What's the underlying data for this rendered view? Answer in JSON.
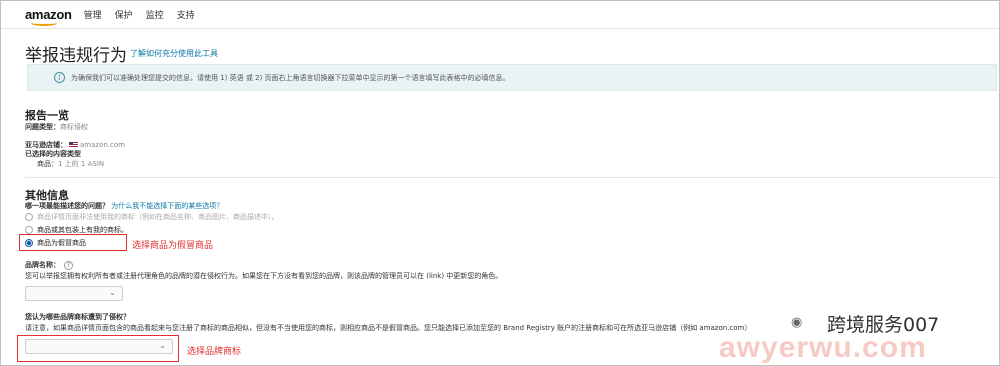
{
  "topbar": {
    "logo": "amazon",
    "nav": [
      "管理",
      "保护",
      "监控",
      "支持"
    ]
  },
  "page": {
    "title": "举报违规行为",
    "title_link": "了解如何充分使用此工具",
    "info": "为确保我们可以准确处理您提交的信息，请使用 1) 英语 或 2) 页面右上角语言切换器下拉菜单中显示的第一个语言填写此表格中的必填信息。"
  },
  "report": {
    "title": "报告一览",
    "issue_type_label": "问题类型：",
    "issue_type_value": "商标侵权",
    "store_label": "亚马逊店铺：",
    "store_value": "amazon.com",
    "content_type_label": "已选择的内容类型",
    "product_label": "商品：",
    "product_value": "1 上的 1 ASIN"
  },
  "other": {
    "title": "其他信息",
    "question": "哪一项最能描述您的问题？",
    "question_link": "为什么我不能选择下面的某些选项？",
    "options": [
      "商品详情页面非法使用我的商标（例如在商品名称、商品图片、商品描述中）。",
      "商品或其包装上有我的商标。",
      "商品为假冒商品"
    ],
    "selected_note": "选择商品为假冒商品"
  },
  "brand": {
    "label": "品牌名称：",
    "help": "?",
    "description": "您可以举报您拥有权利所有者或注册代理角色的品牌的潜在侵权行为。如果您在下方没有看到您的品牌，则该品牌的管理员可以在 (link) 中更新您的角色。"
  },
  "trademark": {
    "label": "您认为哪些品牌商标遭到了侵权？",
    "description": "请注意，如果商品详情页面包含的商品看起来与您注册了商标的商品相似，但没有不当使用您的商标，则相应商品不是假冒商品。您只能选择已添加至您的 Brand Registry 账户的注册商标和可在所选亚马逊店铺（例如 amazon.com）",
    "note": "选择品牌商标"
  },
  "watermark": {
    "wechat": "公众号",
    "name": "跨境服务007",
    "url": "awyerwu.com"
  }
}
